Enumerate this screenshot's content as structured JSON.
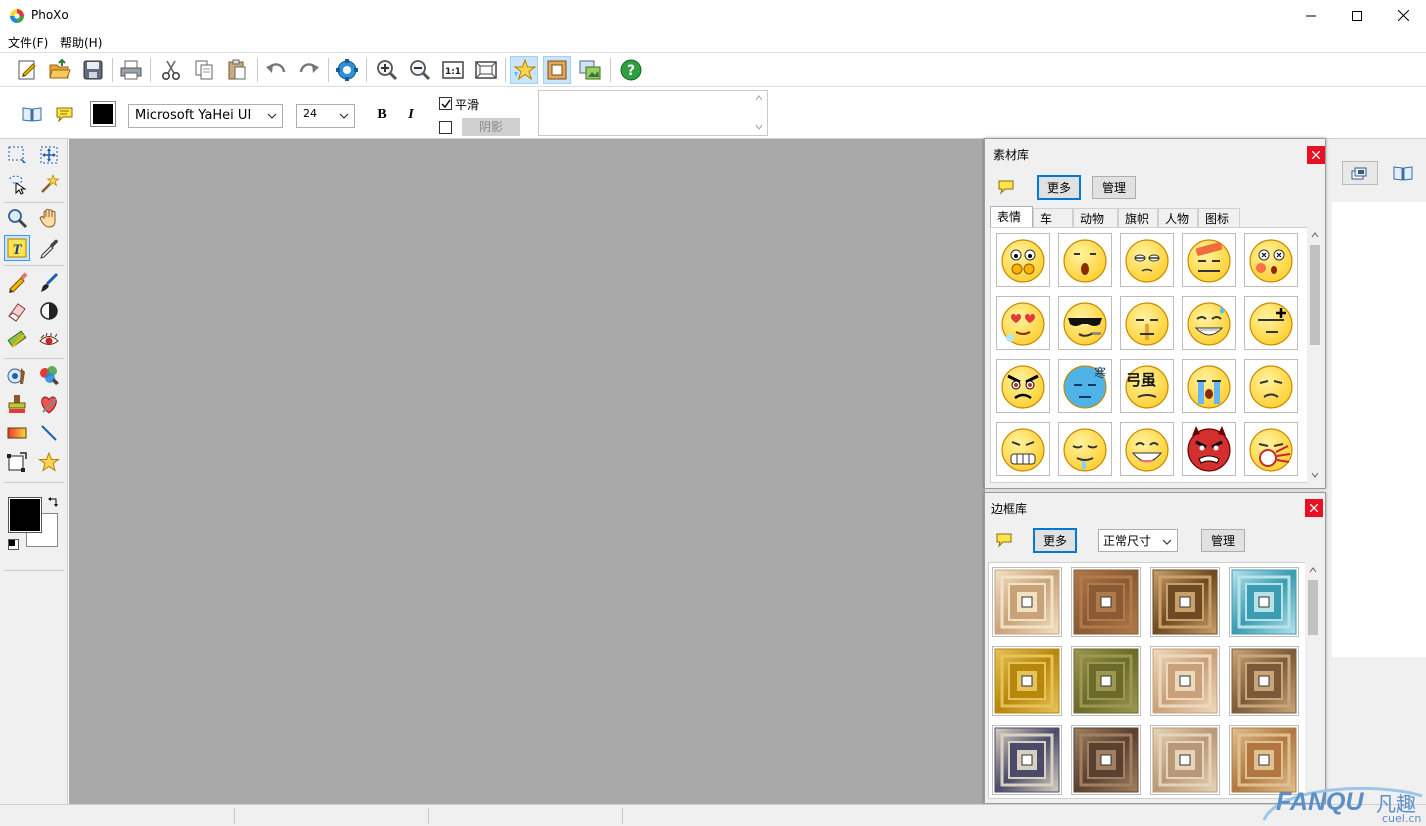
{
  "window": {
    "title": "PhoXo"
  },
  "menu": {
    "items": [
      "文件(F)",
      "帮助(H)"
    ]
  },
  "toolbar": {
    "icons": [
      "new-icon",
      "open-icon",
      "save-icon",
      "print-icon",
      "cut-icon",
      "copy-icon",
      "paste-icon",
      "undo-icon",
      "redo-icon",
      "adjust-icon",
      "zoom-in-icon",
      "zoom-out-icon",
      "actual-size-icon",
      "fit-window-icon",
      "material-library-icon",
      "frame-library-icon",
      "layer-window-icon",
      "help-icon"
    ]
  },
  "text_options": {
    "font_name": "Microsoft YaHei UI",
    "font_size": "24",
    "bold_label": "B",
    "italic_label": "I",
    "smooth_label": "平滑",
    "smooth_checked": true,
    "shadow_label": "阴影",
    "shadow_checked": false,
    "text_color": "#000000"
  },
  "colors": {
    "foreground": "#000000",
    "background": "#ffffff",
    "canvas": "#a9a9a9",
    "accent": "#0078d7"
  },
  "material_panel": {
    "title": "素材库",
    "more_label": "更多",
    "manage_label": "管理",
    "tabs": [
      "表情",
      "车",
      "动物",
      "旗帜",
      "人物",
      "图标"
    ],
    "active_tab": "表情",
    "items": [
      {
        "face": "worried"
      },
      {
        "face": "surprised"
      },
      {
        "face": "sleepy"
      },
      {
        "face": "bandaged"
      },
      {
        "face": "dizzy"
      },
      {
        "face": "love"
      },
      {
        "face": "cool"
      },
      {
        "face": "silent"
      },
      {
        "face": "grin-drop"
      },
      {
        "face": "annoyed"
      },
      {
        "face": "angry"
      },
      {
        "face": "cold"
      },
      {
        "face": "weak"
      },
      {
        "face": "crying"
      },
      {
        "face": "sad"
      },
      {
        "face": "grimace"
      },
      {
        "face": "drool"
      },
      {
        "face": "happy"
      },
      {
        "face": "devil"
      },
      {
        "face": "vomit"
      }
    ]
  },
  "frame_panel": {
    "title": "边框库",
    "more_label": "更多",
    "size_value": "正常尺寸",
    "manage_label": "管理",
    "frames": [
      {
        "color": "#c9a27a",
        "inner": "#f2e2c4"
      },
      {
        "color": "#8a5a34",
        "inner": "#b07a4a"
      },
      {
        "color": "#6e4a22",
        "inner": "#caa06a"
      },
      {
        "color": "#3b9bb0",
        "inner": "#b6e2ea"
      },
      {
        "color": "#b8860b",
        "inner": "#e6c25a"
      },
      {
        "color": "#6b6a2a",
        "inner": "#9c9850"
      },
      {
        "color": "#c8a07a",
        "inner": "#efd9bd"
      },
      {
        "color": "#7a5a3a",
        "inner": "#c9a578"
      },
      {
        "color": "#4a4a6a",
        "inner": "#d8d0c0"
      },
      {
        "color": "#5a4030",
        "inner": "#a08060"
      },
      {
        "color": "#b89878",
        "inner": "#e6d4b8"
      },
      {
        "color": "#b07840",
        "inner": "#e0c090"
      }
    ]
  },
  "watermark": {
    "brand": "FANQU",
    "cn": "凡趣",
    "domain": "cuel.cn"
  }
}
